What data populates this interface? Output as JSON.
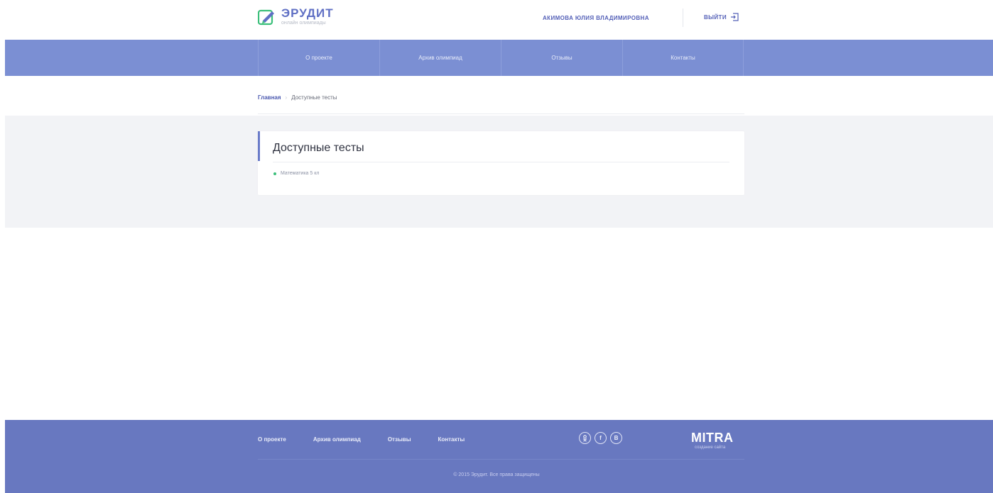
{
  "header": {
    "logo_name": "ЭРУДИТ",
    "logo_sub": "онлайн олимпиады",
    "user_name": "АКИМОВА ЮЛИЯ ВЛАДИМИРОВНА",
    "logout_label": "ВЫЙТИ"
  },
  "topnav": {
    "items": [
      {
        "label": "О проекте"
      },
      {
        "label": "Архив олимпиад"
      },
      {
        "label": "Отзывы"
      },
      {
        "label": "Контакты"
      }
    ]
  },
  "breadcrumb": {
    "home": "Главная",
    "separator": "›",
    "current": "Доступные тесты"
  },
  "content": {
    "title": "Доступные тесты",
    "tests": [
      {
        "label": "Математика 5 кл"
      }
    ]
  },
  "footer": {
    "links": [
      {
        "label": "О проекте"
      },
      {
        "label": "Архив олимпиад"
      },
      {
        "label": "Отзывы"
      },
      {
        "label": "Контакты"
      }
    ],
    "social": [
      {
        "glyph": "Ok",
        "icon": "odnoklassniki-icon"
      },
      {
        "glyph": "f",
        "icon": "facebook-icon"
      },
      {
        "glyph": "B",
        "icon": "vkontakte-icon"
      }
    ],
    "mitra_name": "MITRA",
    "mitra_sub": "создание сайта",
    "copyright": "© 2015 Эрудит. Все права защищены"
  },
  "colors": {
    "nav_bg": "#7b8fd3",
    "footer_bg": "#6878c0",
    "accent": "#5f6fc4",
    "bullet": "#3bbf7a"
  }
}
